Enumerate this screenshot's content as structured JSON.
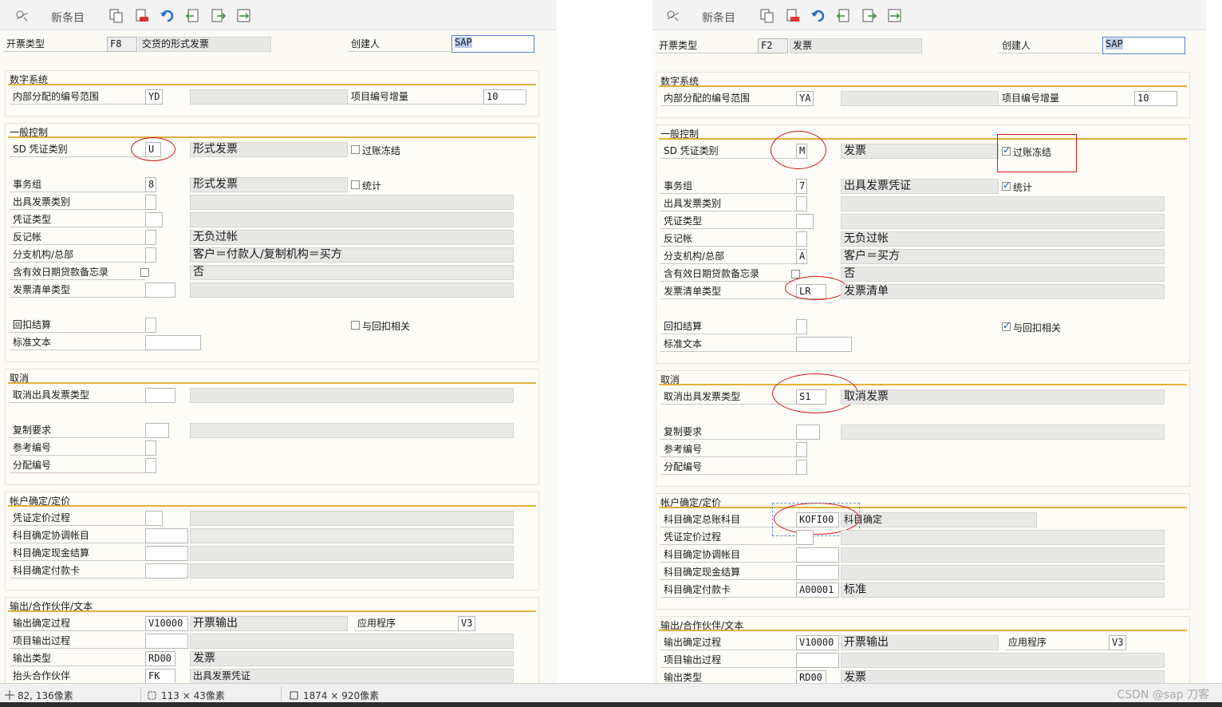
{
  "toolbar": {
    "new_entries": "新条目"
  },
  "left": {
    "header": {
      "invoice_type_label": "开票类型",
      "invoice_type_code": "F8",
      "invoice_type_desc": "交货的形式发票",
      "creator_label": "创建人",
      "creator_value": "SAP"
    },
    "numbering": {
      "title": "数字系统",
      "internal_range_label": "内部分配的编号范围",
      "internal_range_value": "YD",
      "item_incr_label": "项目编号增量",
      "item_incr_value": "10"
    },
    "general": {
      "title": "一般控制",
      "sd_doc_cat_label": "SD 凭证类别",
      "sd_doc_cat_value": "U",
      "sd_doc_cat_desc": "形式发票",
      "posting_block_label": "过账冻结",
      "txn_group_label": "事务组",
      "txn_group_value": "8",
      "txn_group_desc": "形式发票",
      "statistics_label": "统计",
      "billing_cat_label": "出具发票类别",
      "doc_type_label": "凭证类型",
      "rev_post_label": "反记帐",
      "rev_post_desc": "无负过帐",
      "branch_label": "分支机构/总部",
      "branch_desc": "客户＝付款人/复制机构＝买方",
      "credit_memo_label": "含有效日期贷款备忘录",
      "credit_memo_desc": "否",
      "list_type_label": "发票清单类型",
      "rebate_label": "回扣结算",
      "rebate_rel_label": "与回扣相关",
      "std_text_label": "标准文本"
    },
    "cancel": {
      "title": "取消",
      "cancel_type_label": "取消出具发票类型",
      "copy_req_label": "复制要求",
      "ref_no_label": "参考编号",
      "assign_no_label": "分配编号"
    },
    "account": {
      "title": "帐户确定/定价",
      "doc_pricing_label": "凭证定价过程",
      "recon_label": "科目确定协调帐目",
      "cash_label": "科目确定现金结算",
      "card_label": "科目确定付款卡"
    },
    "output": {
      "title": "输出/合作伙伴/文本",
      "output_proc_label": "输出确定过程",
      "output_proc_value": "V10000",
      "output_proc_desc": "开票输出",
      "app_label": "应用程序",
      "app_value": "V3",
      "item_output_label": "项目输出过程",
      "output_type_label": "输出类型",
      "output_type_value": "RD00",
      "output_type_desc": "发票",
      "header_partner_label": "抬头合作伙伴",
      "header_partner_value": "FK",
      "header_partner_desc": "出具发票凭证"
    }
  },
  "right": {
    "header": {
      "invoice_type_label": "开票类型",
      "invoice_type_code": "F2",
      "invoice_type_desc": "发票",
      "creator_label": "创建人",
      "creator_value": "SAP"
    },
    "numbering": {
      "title": "数字系统",
      "internal_range_label": "内部分配的编号范围",
      "internal_range_value": "YA",
      "item_incr_label": "项目编号增量",
      "item_incr_value": "10"
    },
    "general": {
      "title": "一般控制",
      "sd_doc_cat_label": "SD 凭证类别",
      "sd_doc_cat_value": "M",
      "sd_doc_cat_desc": "发票",
      "posting_block_label": "过账冻结",
      "txn_group_label": "事务组",
      "txn_group_value": "7",
      "txn_group_desc": "出具发票凭证",
      "statistics_label": "统计",
      "billing_cat_label": "出具发票类别",
      "doc_type_label": "凭证类型",
      "rev_post_label": "反记帐",
      "rev_post_desc": "无负过帐",
      "branch_label": "分支机构/总部",
      "branch_value": "A",
      "branch_desc": "客户＝买方",
      "credit_memo_label": "含有效日期贷款备忘录",
      "credit_memo_desc": "否",
      "list_type_label": "发票清单类型",
      "list_type_value": "LR",
      "list_type_desc": "发票清单",
      "rebate_label": "回扣结算",
      "rebate_rel_label": "与回扣相关",
      "std_text_label": "标准文本"
    },
    "cancel": {
      "title": "取消",
      "cancel_type_label": "取消出具发票类型",
      "cancel_type_value": "S1",
      "cancel_type_desc": "取消发票",
      "copy_req_label": "复制要求",
      "ref_no_label": "参考编号",
      "assign_no_label": "分配编号"
    },
    "account": {
      "title": "帐户确定/定价",
      "gl_label": "科目确定总账科目",
      "gl_value": "KOFI00",
      "gl_desc": "科目确定",
      "doc_pricing_label": "凭证定价过程",
      "recon_label": "科目确定协调帐目",
      "cash_label": "科目确定现金结算",
      "card_label": "科目确定付款卡",
      "card_value": "A00001",
      "card_desc": "标准"
    },
    "output": {
      "title": "输出/合作伙伴/文本",
      "output_proc_label": "输出确定过程",
      "output_proc_value": "V10000",
      "output_proc_desc": "开票输出",
      "app_label": "应用程序",
      "app_value": "V3",
      "item_output_label": "项目输出过程",
      "output_type_label": "输出类型",
      "output_type_value": "RD00",
      "output_type_desc": "发票"
    }
  },
  "status": {
    "cursor": "82, 136像素",
    "selection": "113 × 43像素",
    "image_size": "1874 × 920像素"
  },
  "watermark": "CSDN @sap 刀客",
  "colors": {
    "accent_line": "#e2b13c",
    "annotation": "#d01818",
    "selection": "#b9cce8"
  }
}
